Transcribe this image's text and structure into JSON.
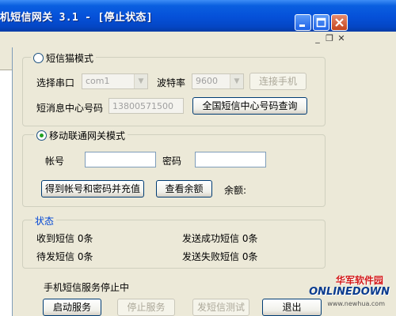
{
  "window": {
    "title": "机短信网关 3.1 - [停止状态]"
  },
  "modem_group": {
    "legend": "短信猫模式",
    "port_label": "选择串口",
    "port_value": "com1",
    "baud_label": "波特率",
    "baud_value": "9600",
    "connect_button": "连接手机",
    "center_label": "短消息中心号码",
    "center_value": "13800571500",
    "query_button": "全国短信中心号码查询"
  },
  "gateway_group": {
    "legend": "移动联通网关模式",
    "account_label": "帐号",
    "password_label": "密码",
    "get_account_button": "得到帐号和密码并充值",
    "check_balance_button": "查看余额",
    "balance_label": "余额:"
  },
  "status_group": {
    "legend": "状态",
    "received": "收到短信 0条",
    "pending": "待发短信 0条",
    "sent_ok": "发送成功短信 0条",
    "sent_fail": "发送失败短信 0条"
  },
  "service_status": "手机短信服务停止中",
  "actions": {
    "start": "启动服务",
    "stop": "停止服务",
    "test": "发短信测试",
    "exit": "退出"
  },
  "watermark": {
    "brand": "华军软件园",
    "logo": "ONLINEDOWN",
    "url": "www.newhua.com"
  }
}
